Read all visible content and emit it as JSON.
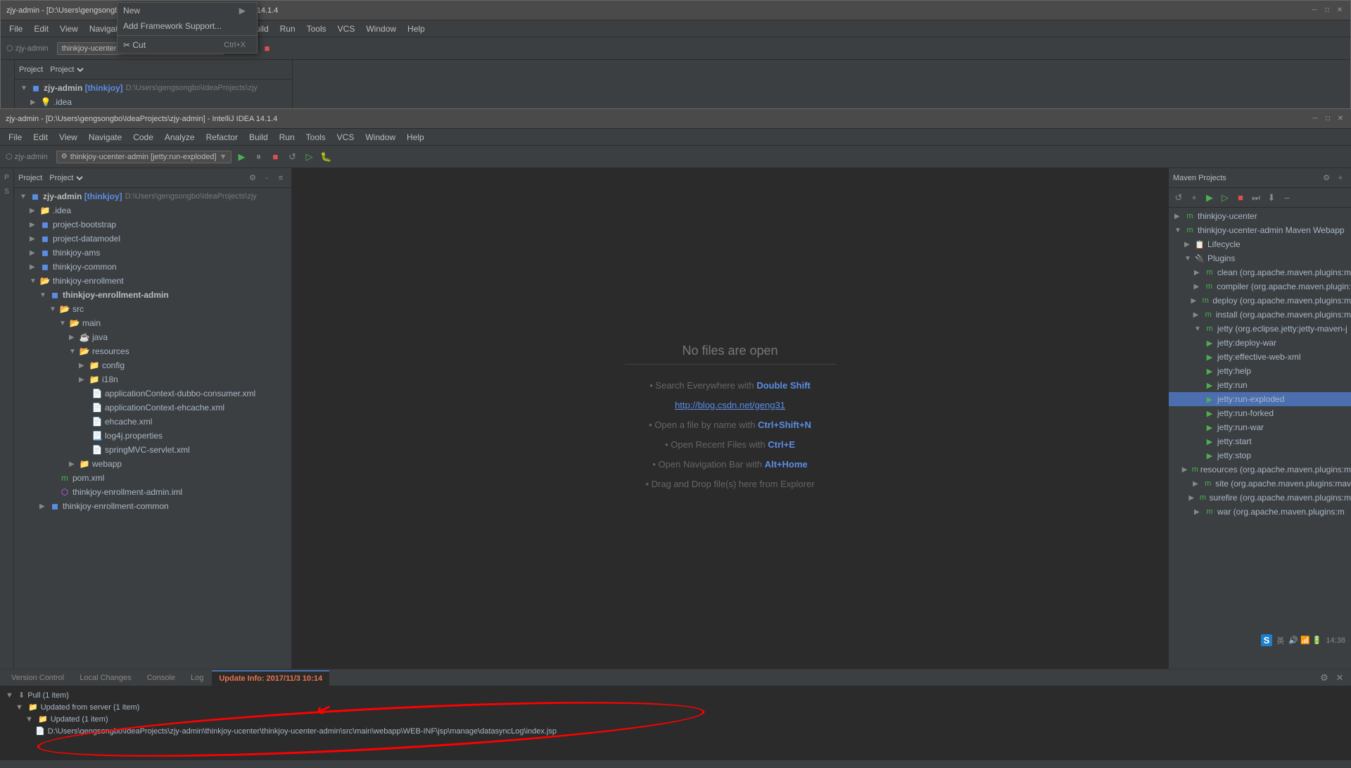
{
  "app": {
    "title": "zjy-admin - [D:\\Users\\gengsongbo\\IdeaProjects\\zjy-admin] - IntelliJ IDEA 14.1.4",
    "name": "zjy-admin"
  },
  "windows": [
    {
      "id": "bg",
      "title": "zjy-admin - [D:\\Users\\gengsongbo\\IdeaProjects\\zjy-admin] - IntelliJ IDEA 14.1.4"
    },
    {
      "id": "fg",
      "title": "zjy-admin - [D:\\Users\\gengsongbo\\IdeaProjects\\zjy-admin] - IntelliJ IDEA 14.1.4"
    }
  ],
  "menu": {
    "items": [
      "File",
      "Edit",
      "View",
      "Navigate",
      "Code",
      "Analyze",
      "Refactor",
      "Build",
      "Run",
      "Tools",
      "VCS",
      "Window",
      "Help"
    ]
  },
  "project_panel": {
    "header": "Project",
    "tree": [
      {
        "id": "root",
        "label": "zjy-admin [thinkjoy]",
        "sublabel": "D:\\Users\\gengsongbo\\IdeaProjects\\zjy",
        "indent": 0,
        "type": "root",
        "expanded": true
      },
      {
        "id": "idea",
        "label": ".idea",
        "indent": 1,
        "type": "folder",
        "expanded": false
      },
      {
        "id": "proj-bootstrap",
        "label": "project-bootstrap",
        "indent": 1,
        "type": "module",
        "expanded": false
      },
      {
        "id": "proj-datamodel",
        "label": "project-datamodel",
        "indent": 1,
        "type": "module",
        "expanded": false
      },
      {
        "id": "thinkjoy-ams",
        "label": "thinkjoy-ams",
        "indent": 1,
        "type": "module",
        "expanded": false
      },
      {
        "id": "thinkjoy-common",
        "label": "thinkjoy-common",
        "indent": 1,
        "type": "module",
        "expanded": false
      },
      {
        "id": "thinkjoy-enrollment",
        "label": "thinkjoy-enrollment",
        "indent": 1,
        "type": "folder",
        "expanded": true
      },
      {
        "id": "enrollment-admin",
        "label": "thinkjoy-enrollment-admin",
        "indent": 2,
        "type": "module",
        "expanded": true
      },
      {
        "id": "src",
        "label": "src",
        "indent": 3,
        "type": "folder",
        "expanded": true
      },
      {
        "id": "main",
        "label": "main",
        "indent": 4,
        "type": "folder",
        "expanded": true
      },
      {
        "id": "java",
        "label": "java",
        "indent": 5,
        "type": "folder",
        "expanded": false
      },
      {
        "id": "resources",
        "label": "resources",
        "indent": 5,
        "type": "folder",
        "expanded": true
      },
      {
        "id": "config",
        "label": "config",
        "indent": 6,
        "type": "folder",
        "expanded": false
      },
      {
        "id": "i18n",
        "label": "i18n",
        "indent": 6,
        "type": "folder",
        "expanded": false
      },
      {
        "id": "app-dubbo",
        "label": "applicationContext-dubbo-consumer.xml",
        "indent": 6,
        "type": "xml"
      },
      {
        "id": "app-ehcache",
        "label": "applicationContext-ehcache.xml",
        "indent": 6,
        "type": "xml"
      },
      {
        "id": "ehcache",
        "label": "ehcache.xml",
        "indent": 6,
        "type": "xml"
      },
      {
        "id": "log4j",
        "label": "log4j.properties",
        "indent": 6,
        "type": "props"
      },
      {
        "id": "springmvc",
        "label": "springMVC-servlet.xml",
        "indent": 6,
        "type": "xml"
      },
      {
        "id": "webapp",
        "label": "webapp",
        "indent": 5,
        "type": "folder",
        "expanded": false
      },
      {
        "id": "pom",
        "label": "pom.xml",
        "indent": 4,
        "type": "xml"
      },
      {
        "id": "enrollment-admin-iml",
        "label": "thinkjoy-enrollment-admin.iml",
        "indent": 4,
        "type": "iml"
      },
      {
        "id": "enrollment-common",
        "label": "thinkjoy-enrollment-common",
        "indent": 2,
        "type": "module",
        "expanded": false
      }
    ]
  },
  "editor": {
    "no_files_title": "No files are open",
    "hints": [
      {
        "text": "• Search Everywhere with ",
        "key": "Double Shift",
        "after": ""
      },
      {
        "text": "http://blog.csdn.net/geng31",
        "key": "",
        "after": "",
        "isLink": true
      },
      {
        "text": "• Open a file by name with ",
        "key": "Ctrl+Shift+N",
        "after": ""
      },
      {
        "text": "• Open Recent Files with ",
        "key": "Ctrl+E",
        "after": ""
      },
      {
        "text": "• Open Navigation Bar with ",
        "key": "Alt+Home",
        "after": ""
      },
      {
        "text": "• Drag and Drop file(s) here from Explorer",
        "key": "",
        "after": ""
      }
    ]
  },
  "maven_panel": {
    "title": "Maven Projects",
    "tree": [
      {
        "id": "thinkjoy-ucenter",
        "label": "thinkjoy-ucenter",
        "indent": 0,
        "type": "maven",
        "expanded": false
      },
      {
        "id": "ucenter-admin-webapp",
        "label": "thinkjoy-ucenter-admin Maven Webapp",
        "indent": 0,
        "type": "maven",
        "expanded": true
      },
      {
        "id": "lifecycle",
        "label": "Lifecycle",
        "indent": 1,
        "type": "folder",
        "expanded": false
      },
      {
        "id": "plugins",
        "label": "Plugins",
        "indent": 1,
        "type": "folder",
        "expanded": true
      },
      {
        "id": "clean",
        "label": "clean",
        "sublabel": "(org.apache.maven.plugins:m",
        "indent": 2,
        "type": "plugin"
      },
      {
        "id": "compiler",
        "label": "compiler",
        "sublabel": "(org.apache.maven.plugin:",
        "indent": 2,
        "type": "plugin"
      },
      {
        "id": "deploy",
        "label": "deploy",
        "sublabel": "(org.apache.maven.plugins:m",
        "indent": 2,
        "type": "plugin"
      },
      {
        "id": "install",
        "label": "install",
        "sublabel": "(org.apache.maven.plugins:m",
        "indent": 2,
        "type": "plugin"
      },
      {
        "id": "jetty",
        "label": "jetty",
        "sublabel": "(org.eclipse.jetty:jetty-maven-j",
        "indent": 2,
        "type": "plugin",
        "expanded": true
      },
      {
        "id": "jetty-deploy-war",
        "label": "jetty:deploy-war",
        "indent": 3,
        "type": "goal"
      },
      {
        "id": "jetty-effective-web-xml",
        "label": "jetty:effective-web-xml",
        "indent": 3,
        "type": "goal"
      },
      {
        "id": "jetty-help",
        "label": "jetty:help",
        "indent": 3,
        "type": "goal"
      },
      {
        "id": "jetty-run",
        "label": "jetty:run",
        "indent": 3,
        "type": "goal"
      },
      {
        "id": "jetty-run-exploded",
        "label": "jetty:run-exploded",
        "indent": 3,
        "type": "goal",
        "selected": true
      },
      {
        "id": "jetty-run-forked",
        "label": "jetty:run-forked",
        "indent": 3,
        "type": "goal"
      },
      {
        "id": "jetty-run-war",
        "label": "jetty:run-war",
        "indent": 3,
        "type": "goal"
      },
      {
        "id": "jetty-start",
        "label": "jetty:start",
        "indent": 3,
        "type": "goal"
      },
      {
        "id": "jetty-stop",
        "label": "jetty:stop",
        "indent": 3,
        "type": "goal"
      },
      {
        "id": "resources",
        "label": "resources",
        "sublabel": "(org.apache.maven.plugins:m",
        "indent": 2,
        "type": "plugin"
      },
      {
        "id": "site",
        "label": "site",
        "sublabel": "(org.apache.maven.plugins:mav",
        "indent": 2,
        "type": "plugin"
      },
      {
        "id": "surefire",
        "label": "surefire",
        "sublabel": "(org.apache.maven.plugins:m",
        "indent": 2,
        "type": "plugin"
      },
      {
        "id": "war",
        "label": "war",
        "sublabel": "(org.apache.maven.plugins:m",
        "indent": 2,
        "type": "plugin"
      }
    ]
  },
  "run_config": {
    "top_label": "thinkjoy-ucenter-admin [jetty:run-exploded]",
    "bottom_label": "thinkjoy-ucenter-admin [jetty:run-exploded]"
  },
  "bottom_panel": {
    "tabs": [
      "Version Control",
      "Local Changes",
      "Console",
      "Log",
      "Update Info: 2017/11/3 10:14"
    ],
    "active_tab": "Update Info: 2017/11/3 10:14",
    "content": {
      "pull_item": "Pull (1 item)",
      "updated_from_server": "Updated from server (1 item)",
      "updated": "Updated (1 item)",
      "file_path": "D:\\Users\\gengsongbo\\IdeaProjects\\zjy-admin\\thinkjoy-ucenter\\thinkjoy-ucenter-admin\\src\\main\\webapp\\WEB-INF\\jsp\\manage\\datasyncLog\\index.jsp"
    }
  },
  "context_menu": {
    "items": [
      {
        "label": "New",
        "arrow": "▶",
        "shortcut": ""
      },
      {
        "label": "Add Framework Support...",
        "arrow": "",
        "shortcut": ""
      },
      {
        "separator": true
      },
      {
        "label": "Cut",
        "arrow": "",
        "shortcut": "Ctrl+X"
      }
    ]
  }
}
